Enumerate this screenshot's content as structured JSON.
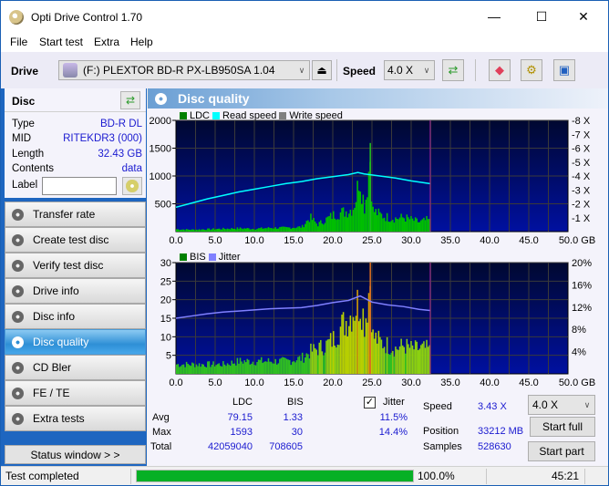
{
  "window": {
    "title": "Opti Drive Control 1.70",
    "minimize_glyph": "—",
    "maximize_glyph": "☐",
    "close_glyph": "✕"
  },
  "menu": [
    "File",
    "Start test",
    "Extra",
    "Help"
  ],
  "toolbar": {
    "drive_label": "Drive",
    "drive_value": "(F:)   PLEXTOR BD-R  PX-LB950SA 1.04",
    "speed_label": "Speed",
    "speed_value": "4.0 X",
    "eject_glyph": "⏏",
    "icons": [
      "refresh-icon",
      "eraser-icon",
      "settings-icon",
      "save-icon"
    ]
  },
  "disc": {
    "title": "Disc",
    "rows": [
      {
        "label": "Type",
        "value": "BD-R DL"
      },
      {
        "label": "MID",
        "value": "RITEKDR3 (000)"
      },
      {
        "label": "Length",
        "value": "32.43 GB"
      },
      {
        "label": "Contents",
        "value": "data"
      }
    ],
    "label_label": "Label",
    "label_value": ""
  },
  "nav": [
    {
      "label": "Transfer rate",
      "active": false
    },
    {
      "label": "Create test disc",
      "active": false
    },
    {
      "label": "Verify test disc",
      "active": false
    },
    {
      "label": "Drive info",
      "active": false
    },
    {
      "label": "Disc info",
      "active": false
    },
    {
      "label": "Disc quality",
      "active": true
    },
    {
      "label": "CD Bler",
      "active": false
    },
    {
      "label": "FE / TE",
      "active": false
    },
    {
      "label": "Extra tests",
      "active": false
    }
  ],
  "status_window_label": "Status window > >",
  "panel_title": "Disc quality",
  "chart_data": [
    {
      "type": "bar",
      "title": "LDC / Read speed",
      "legend": [
        {
          "name": "LDC",
          "color": "#008000"
        },
        {
          "name": "Read speed",
          "color": "#00ffff"
        },
        {
          "name": "Write speed",
          "color": "#808080"
        }
      ],
      "legend_position": "top-left",
      "x_ticks": [
        "0.0",
        "5.0",
        "10.0",
        "15.0",
        "20.0",
        "25.0",
        "30.0",
        "35.0",
        "40.0",
        "45.0",
        "50.0 GB"
      ],
      "xlim": [
        0,
        50
      ],
      "y_left_ticks": [
        "500",
        "1000",
        "1500",
        "2000"
      ],
      "ylim_left": [
        0,
        2000
      ],
      "y_right_ticks": [
        "1 X",
        "2 X",
        "3 X",
        "4 X",
        "5 X",
        "6 X",
        "7 X",
        "8 X"
      ],
      "ylim_right": [
        0,
        8
      ],
      "disc_end_gb": 32.43,
      "series": [
        {
          "name": "LDC",
          "x": [
            0,
            2,
            4,
            6,
            8,
            10,
            12,
            14,
            16,
            17,
            18,
            19,
            20,
            21,
            22,
            22.5,
            23,
            23.3,
            23.6,
            24,
            24.7,
            25,
            26,
            27,
            28,
            29,
            30,
            31,
            32,
            32.4
          ],
          "y": [
            50,
            40,
            50,
            60,
            70,
            60,
            80,
            80,
            100,
            300,
            150,
            250,
            350,
            400,
            450,
            500,
            800,
            1250,
            900,
            500,
            1593,
            450,
            350,
            300,
            280,
            300,
            250,
            200,
            250,
            200
          ]
        },
        {
          "name": "Read speed",
          "x": [
            0,
            2,
            4,
            6,
            8,
            10,
            12,
            14,
            16,
            18,
            20,
            22,
            23.2,
            24,
            26,
            28,
            30,
            32.4
          ],
          "y": [
            1.75,
            2.05,
            2.35,
            2.6,
            2.85,
            3.05,
            3.25,
            3.45,
            3.6,
            3.8,
            3.95,
            4.1,
            4.25,
            4.15,
            4.0,
            3.85,
            3.65,
            3.45
          ]
        }
      ]
    },
    {
      "type": "bar",
      "title": "BIS / Jitter",
      "legend": [
        {
          "name": "BIS",
          "color": "#008000"
        },
        {
          "name": "Jitter",
          "color": "#8080ff"
        }
      ],
      "legend_position": "top-left",
      "x_ticks": [
        "0.0",
        "5.0",
        "10.0",
        "15.0",
        "20.0",
        "25.0",
        "30.0",
        "35.0",
        "40.0",
        "45.0",
        "50.0 GB"
      ],
      "xlim": [
        0,
        50
      ],
      "y_left_ticks": [
        "5",
        "10",
        "15",
        "20",
        "25",
        "30"
      ],
      "ylim_left": [
        0,
        30
      ],
      "y_right_ticks": [
        "4%",
        "8%",
        "12%",
        "16%",
        "20%"
      ],
      "ylim_right": [
        0,
        20
      ],
      "disc_end_gb": 32.43,
      "series": [
        {
          "name": "BIS",
          "x": [
            0,
            2,
            4,
            6,
            8,
            10,
            12,
            14,
            16,
            17,
            18,
            19,
            20,
            21,
            22,
            22.5,
            23,
            23.5,
            24,
            24.7,
            25,
            26,
            27,
            28,
            29,
            30,
            31,
            32,
            32.4
          ],
          "y": [
            3,
            3,
            3,
            3,
            4,
            4,
            4,
            4,
            5,
            7,
            8,
            9,
            11,
            15,
            18,
            20,
            22,
            23,
            16,
            30,
            12,
            10,
            9,
            8,
            9,
            8,
            8,
            8,
            7
          ]
        },
        {
          "name": "Jitter",
          "x": [
            0,
            2,
            4,
            6,
            8,
            10,
            12,
            14,
            16,
            18,
            20,
            22,
            23.5,
            25,
            27,
            29,
            31,
            32.4
          ],
          "y": [
            10.0,
            10.4,
            10.8,
            11.1,
            11.3,
            11.5,
            11.7,
            11.8,
            11.9,
            12.3,
            12.8,
            13.2,
            14.0,
            12.9,
            12.4,
            12.1,
            11.6,
            11.4
          ]
        }
      ]
    }
  ],
  "stats": {
    "col_ldc": "LDC",
    "col_bis": "BIS",
    "jitter_label": "Jitter",
    "jitter_checked": true,
    "rows": [
      {
        "label": "Avg",
        "ldc": "79.15",
        "bis": "1.33",
        "jitter": "11.5%"
      },
      {
        "label": "Max",
        "ldc": "1593",
        "bis": "30",
        "jitter": "14.4%"
      },
      {
        "label": "Total",
        "ldc": "42059040",
        "bis": "708605",
        "jitter": ""
      }
    ],
    "speed_label": "Speed",
    "speed_value": "3.43 X",
    "position_label": "Position",
    "position_value": "33212 MB",
    "samples_label": "Samples",
    "samples_value": "528630",
    "speed_select": "4.0 X",
    "start_full": "Start full",
    "start_part": "Start part"
  },
  "statusbar": {
    "text": "Test completed",
    "progress_percent": 100,
    "progress_text": "100.0%",
    "time": "45:21"
  }
}
